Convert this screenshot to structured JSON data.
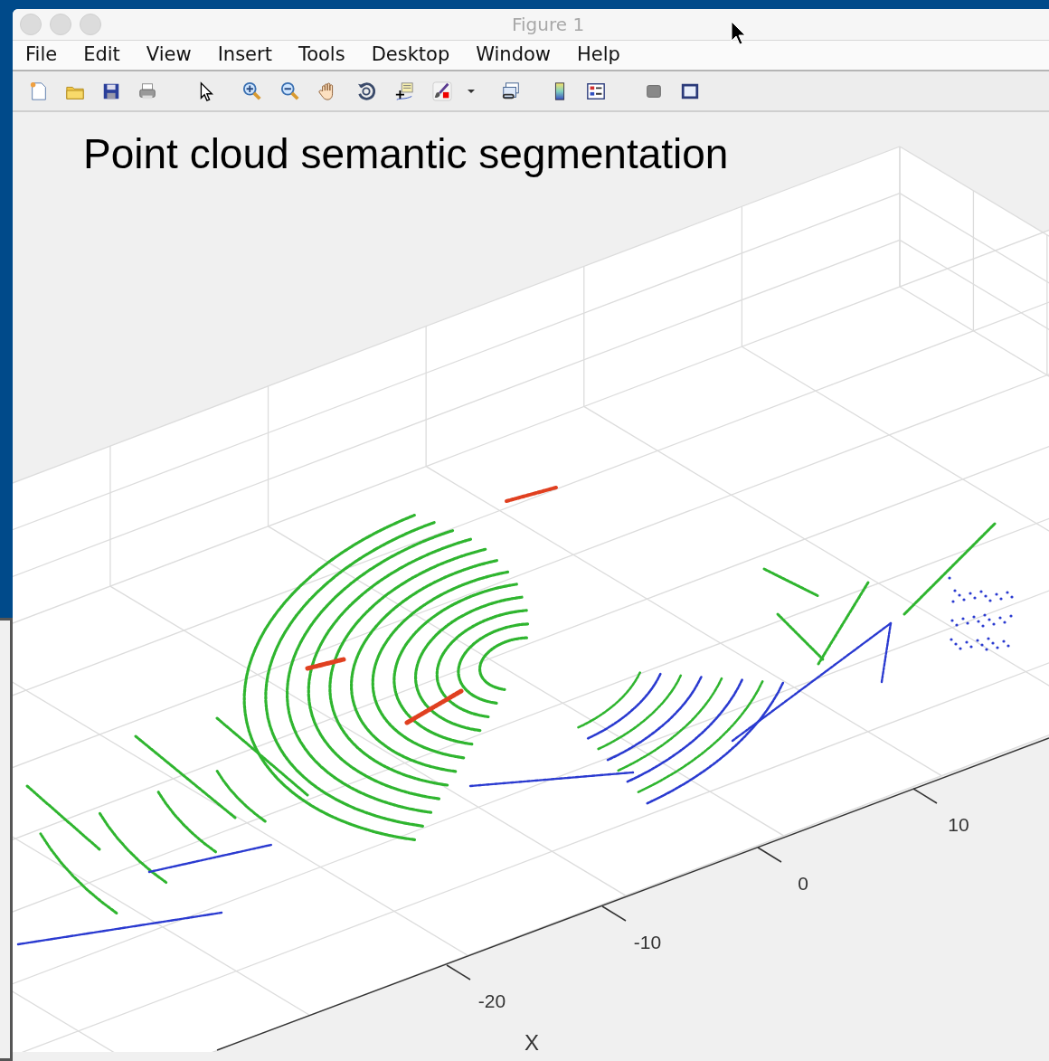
{
  "window": {
    "title": "Figure 1"
  },
  "menu": [
    {
      "label": "File"
    },
    {
      "label": "Edit"
    },
    {
      "label": "View"
    },
    {
      "label": "Insert"
    },
    {
      "label": "Tools"
    },
    {
      "label": "Desktop"
    },
    {
      "label": "Window"
    },
    {
      "label": "Help"
    }
  ],
  "figure": {
    "title": "Point cloud semantic segmentation",
    "x_axis": {
      "ticks": [
        "10",
        "0",
        "-10",
        "-20"
      ],
      "label": "X"
    }
  }
}
